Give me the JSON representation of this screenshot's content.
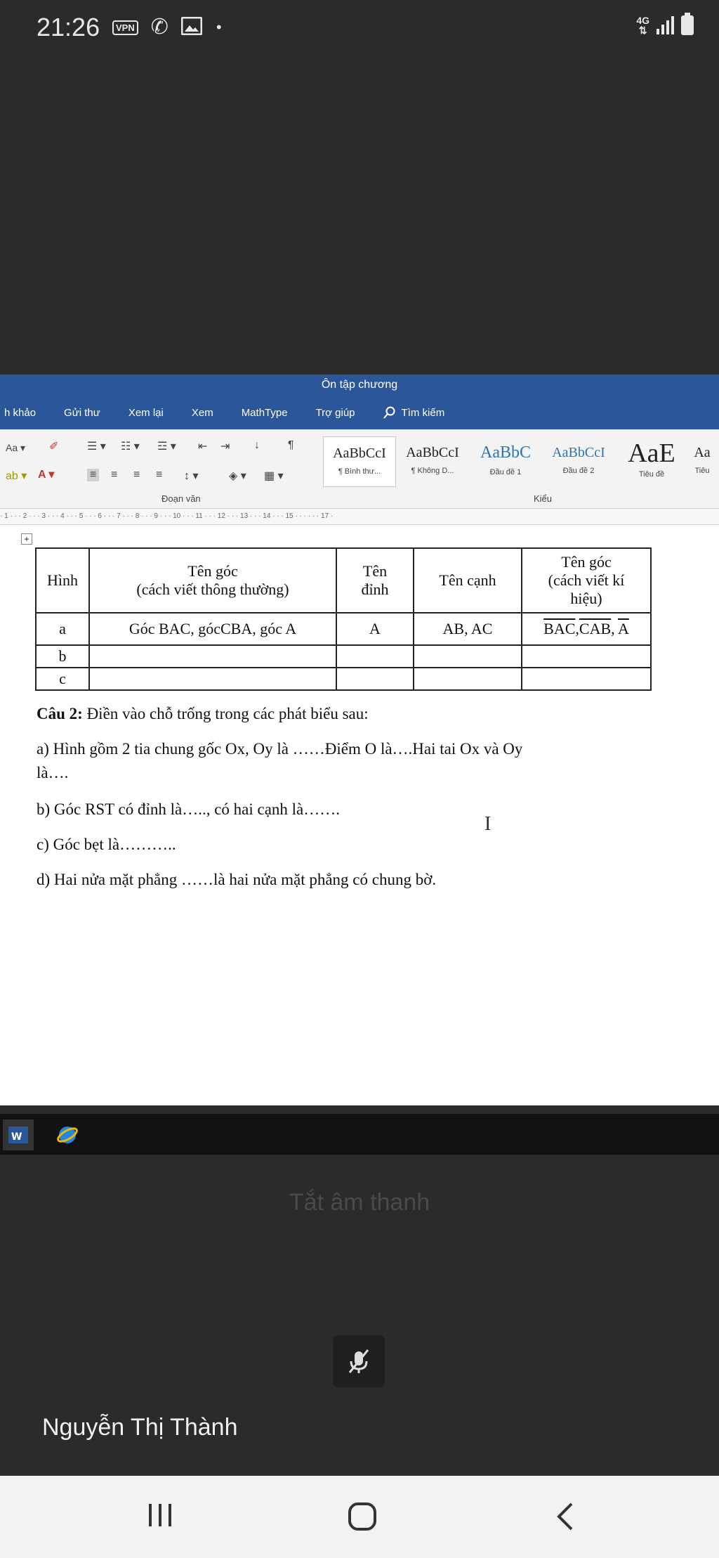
{
  "status_bar": {
    "time": "21:26",
    "vpn": "VPN",
    "network": "4G"
  },
  "word": {
    "title": "Ôn tập chương",
    "tabs": [
      "h khảo",
      "Gửi thư",
      "Xem lại",
      "Xem",
      "MathType",
      "Trợ giúp"
    ],
    "search_label": "Tìm kiếm",
    "font_size_label": "Aa",
    "paragraph_group_label": "Đoạn văn",
    "styles_group_label": "Kiểu",
    "styles": [
      {
        "sample": "AaBbCcI",
        "name": "¶ Bình thư..."
      },
      {
        "sample": "AaBbCcI",
        "name": "¶ Không D..."
      },
      {
        "sample": "AaBbC",
        "name": "Đầu đề 1"
      },
      {
        "sample": "AaBbCcI",
        "name": "Đầu đề 2"
      },
      {
        "sample": "AaE",
        "name": "Tiêu đề"
      },
      {
        "sample": "Aa",
        "name": "Tiêu"
      }
    ],
    "ruler": "· 1 · · · 2 · · · 3 · · · 4 · · · 5 · · · 6 · · · 7 · · · 8 · · · 9 · · · 10 · · · 11 · · · 12 · · · 13 · · · 14 · · · 15 · · · · · · 17 ·",
    "table": {
      "headers": [
        "Hình",
        "Tên góc",
        "(cách viết thông thường)",
        "Tên",
        "đỉnh",
        "Tên cạnh",
        "Tên góc",
        "(cách viết kí",
        "hiệu)"
      ],
      "rows": [
        {
          "hinh": "a",
          "ten_goc": "Góc BAC, gócCBA, góc A",
          "dinh": "A",
          "canh": "AB, AC",
          "ki_hieu_1": "BAC",
          "ki_hieu_sep1": ",",
          "ki_hieu_2": "CAB",
          "ki_hieu_sep2": ", ",
          "ki_hieu_3": "A"
        },
        {
          "hinh": "b"
        },
        {
          "hinh": "c"
        }
      ]
    },
    "questions": {
      "cau2_label": "Câu 2:",
      "cau2_text": " Điền vào chỗ trống trong các phát biểu sau:",
      "a_line1": "a) Hình gồm 2 tia chung gốc Ox, Oy là ……Điểm O là….Hai tai Ox và Oy",
      "a_line2": "là….",
      "b": "b) Góc RST có đỉnh là….., có hai cạnh là…….",
      "c": "c) Góc bẹt là………..",
      "d": "d) Hai nửa mặt phẳng ……là hai nửa mặt phẳng có chung bờ."
    }
  },
  "call": {
    "muted_label": "Tắt âm thanh",
    "participant_name": "Nguyễn Thị Thành"
  },
  "colors": {
    "word_blue": "#2b579a",
    "background": "#2b2b2b"
  }
}
